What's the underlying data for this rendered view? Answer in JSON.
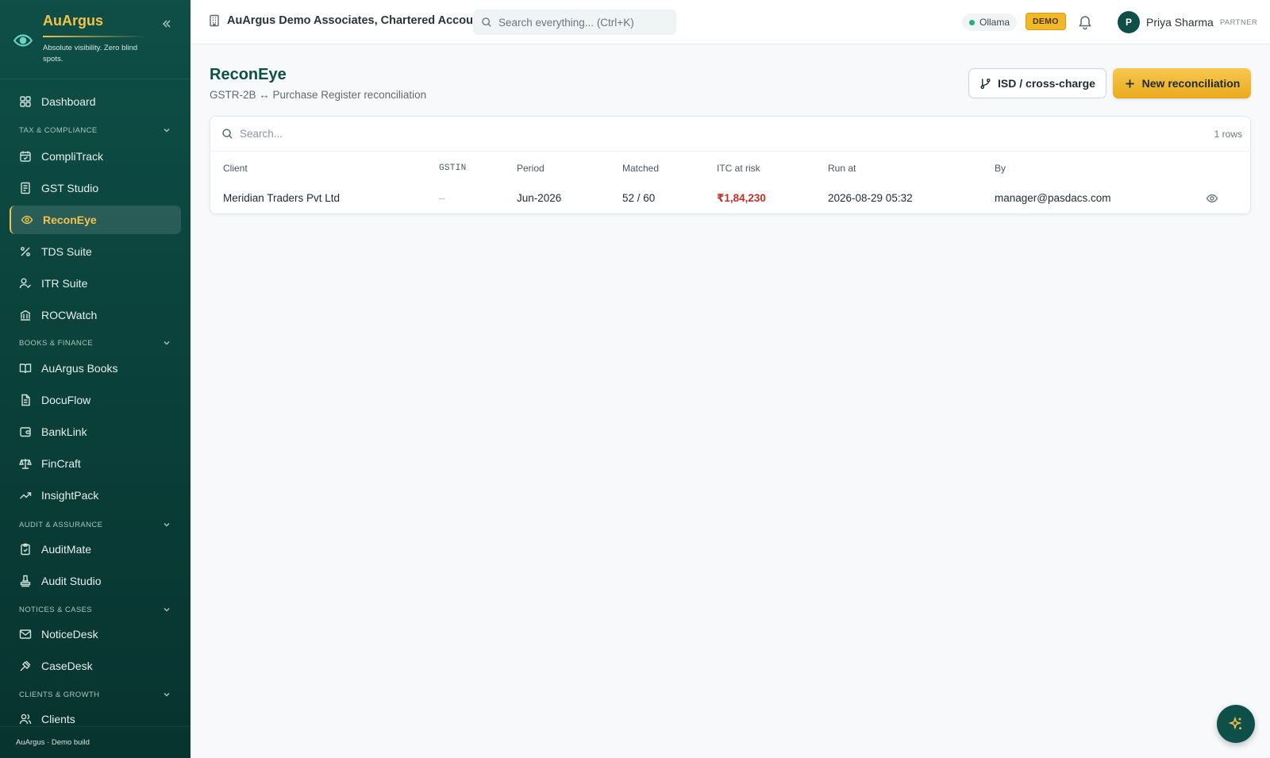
{
  "brand": {
    "name": "AuArgus",
    "tagline": "Absolute visibility. Zero blind spots."
  },
  "sidebar": {
    "items": [
      {
        "label": "Dashboard"
      },
      {
        "section": "TAX & COMPLIANCE"
      },
      {
        "label": "CompliTrack"
      },
      {
        "label": "GST Studio"
      },
      {
        "label": "ReconEye",
        "active": true
      },
      {
        "label": "TDS Suite"
      },
      {
        "label": "ITR Suite"
      },
      {
        "label": "ROCWatch"
      },
      {
        "section": "BOOKS & FINANCE"
      },
      {
        "label": "AuArgus Books"
      },
      {
        "label": "DocuFlow"
      },
      {
        "label": "BankLink"
      },
      {
        "label": "FinCraft"
      },
      {
        "label": "InsightPack"
      },
      {
        "section": "AUDIT & ASSURANCE"
      },
      {
        "label": "AuditMate"
      },
      {
        "label": "Audit Studio"
      },
      {
        "section": "NOTICES & CASES"
      },
      {
        "label": "NoticeDesk"
      },
      {
        "label": "CaseDesk"
      },
      {
        "section": "CLIENTS & GROWTH"
      },
      {
        "label": "Clients"
      }
    ],
    "footer": "AuArgus · Demo build"
  },
  "header": {
    "org_name": "AuArgus Demo Associates, Chartered Accou...",
    "search_placeholder": "Search everything... (Ctrl+K)",
    "ollama_label": "Ollama",
    "demo_badge": "DEMO",
    "user_initial": "P",
    "user_name": "Priya Sharma",
    "user_role": "PARTNER"
  },
  "page": {
    "title": "ReconEye",
    "subtitle": "GSTR-2B ↔ Purchase Register reconciliation",
    "isd_button": "ISD / cross-charge",
    "new_button": "New reconciliation"
  },
  "table": {
    "search_placeholder": "Search...",
    "row_count": "1 rows",
    "columns": [
      "Client",
      "GSTIN",
      "Period",
      "Matched",
      "ITC at risk",
      "Run at",
      "By"
    ],
    "rows": [
      {
        "client": "Meridian Traders Pvt Ltd",
        "gstin": "–",
        "period": "Jun-2026",
        "matched": "52 / 60",
        "itc_at_risk": "₹1,84,230",
        "run_at": "2026-08-29 05:32",
        "by": "manager@pasdacs.com"
      }
    ]
  },
  "colors": {
    "sidebar_bg": "#0e4f47",
    "accent_gold": "#f3c34a",
    "risk_red": "#c0302b",
    "status_green": "#22b07a"
  }
}
